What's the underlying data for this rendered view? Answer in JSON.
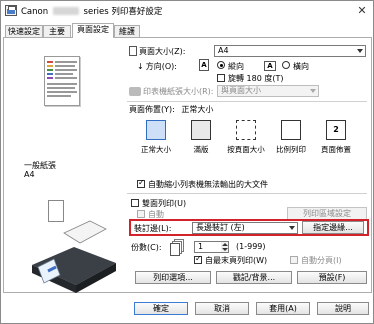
{
  "window": {
    "title_prefix": "Canon",
    "title_suffix": "series 列印喜好設定",
    "close_symbol": "✕"
  },
  "tabs": [
    {
      "label": "快速設定"
    },
    {
      "label": "主要"
    },
    {
      "label": "頁面設定"
    },
    {
      "label": "維護"
    }
  ],
  "preview": {
    "paper_label": "一般紙張",
    "size_label": "A4"
  },
  "page": {
    "size_label": "頁面大小(Z):",
    "size_value": "A4",
    "orientation_label": "方向(O):",
    "portrait_label": "縱向",
    "landscape_label": "橫向",
    "rotate_label": "旋轉 180 度(T)",
    "printer_paper_label": "印表機紙張大小(R):",
    "printer_paper_value": "與頁面大小"
  },
  "layout": {
    "heading": "頁面佈置(Y):",
    "heading_value": "正常大小",
    "options": [
      {
        "label": "正常大小"
      },
      {
        "label": "滿版"
      },
      {
        "label": "按頁面大小"
      },
      {
        "label": "比例列印"
      },
      {
        "label": "頁面佈置"
      }
    ],
    "auto_reduce_label": "自動縮小列表機無法輸出的大文件"
  },
  "duplex": {
    "label": "雙面列印(U)",
    "auto_label": "自動",
    "area_button": "列印區域設定"
  },
  "binding": {
    "label": "裝訂邊(L):",
    "value": "長邊裝訂 (左)",
    "margin_button": "指定邊緣..."
  },
  "copies": {
    "label": "份數(C):",
    "value": "1",
    "range": "(1-999)",
    "reverse_label": "自最末頁列印(W)",
    "collate_label": "自動分頁(I)"
  },
  "bottom_buttons": {
    "print_options": "列印選項...",
    "stamp": "戳記/背景...",
    "defaults": "預設(F)"
  },
  "footer": {
    "ok": "確定",
    "cancel": "取消",
    "apply": "套用(A)",
    "help": "說明"
  },
  "colors": {
    "highlight": "#d3222a",
    "selected_icon": "#cde0f7"
  }
}
